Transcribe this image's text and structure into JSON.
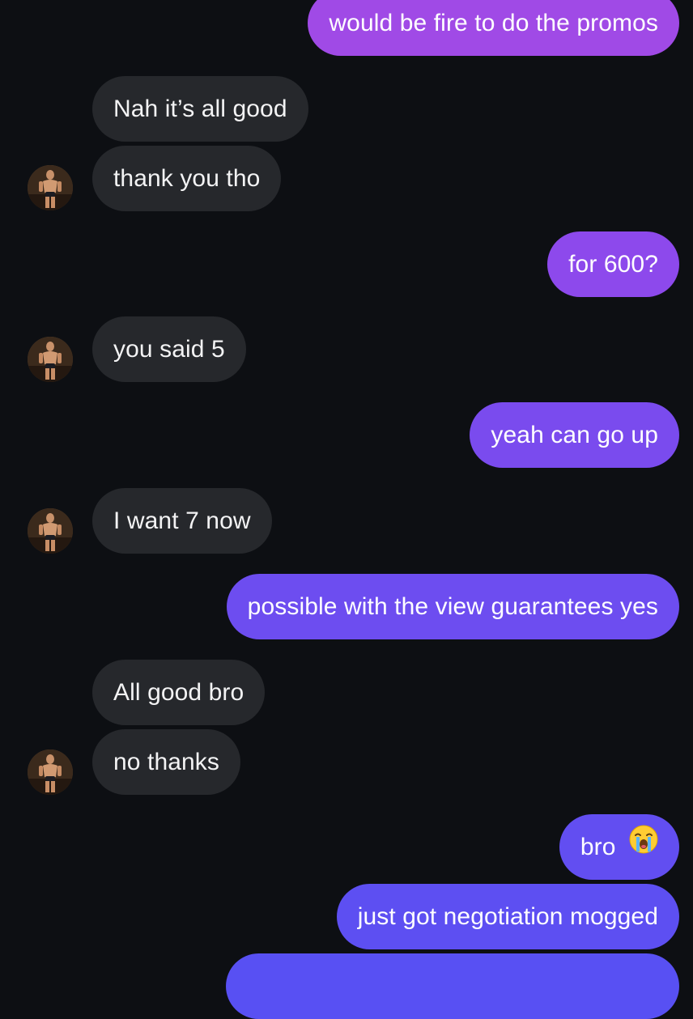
{
  "colors": {
    "background": "#0d0f13",
    "incoming_bubble": "#26282c",
    "outgoing_gradient_top": "#a347e8",
    "outgoing_gradient_bottom": "#5b4ff2"
  },
  "messages": [
    {
      "from": "me",
      "text": "would be fire to do the promos"
    },
    {
      "from": "them",
      "text": "Nah it’s all good"
    },
    {
      "from": "them",
      "text": "thank you tho"
    },
    {
      "from": "me",
      "text": "for 600?"
    },
    {
      "from": "them",
      "text": "you said 5"
    },
    {
      "from": "me",
      "text": "yeah can go up"
    },
    {
      "from": "them",
      "text": "I want 7 now"
    },
    {
      "from": "me",
      "text": "possible with the view guarantees yes"
    },
    {
      "from": "them",
      "text": "All good bro"
    },
    {
      "from": "them",
      "text": "no thanks"
    },
    {
      "from": "me",
      "text": "bro",
      "emoji": "loudly-crying-face-icon"
    },
    {
      "from": "me",
      "text": "just got negotiation mogged"
    },
    {
      "from": "me",
      "text": ""
    }
  ]
}
